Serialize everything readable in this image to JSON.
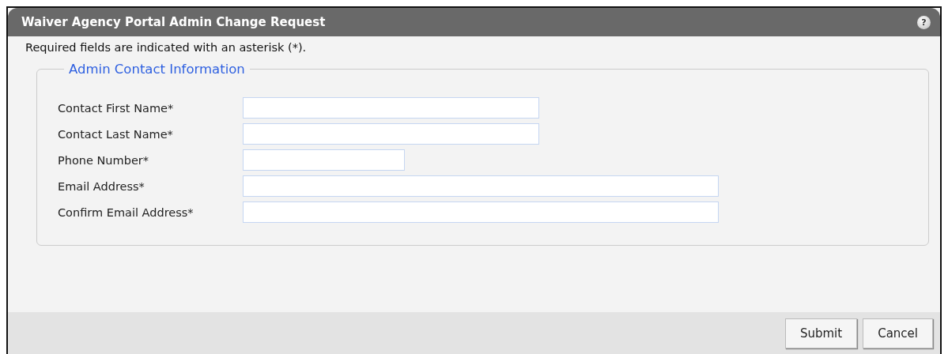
{
  "window": {
    "title": "Waiver Agency Portal Admin Change Request",
    "help": "?"
  },
  "note": "Required fields are indicated with an asterisk (*).",
  "section": {
    "legend": "Admin Contact Information",
    "fields": [
      {
        "label": "Contact First Name*",
        "kind": "name"
      },
      {
        "label": "Contact Last Name*",
        "kind": "name"
      },
      {
        "label": "Phone Number*",
        "kind": "phone"
      },
      {
        "label": "Email Address*",
        "kind": "email"
      },
      {
        "label": "Confirm Email Address*",
        "kind": "email"
      }
    ]
  },
  "buttons": [
    "Submit",
    "Cancel"
  ]
}
